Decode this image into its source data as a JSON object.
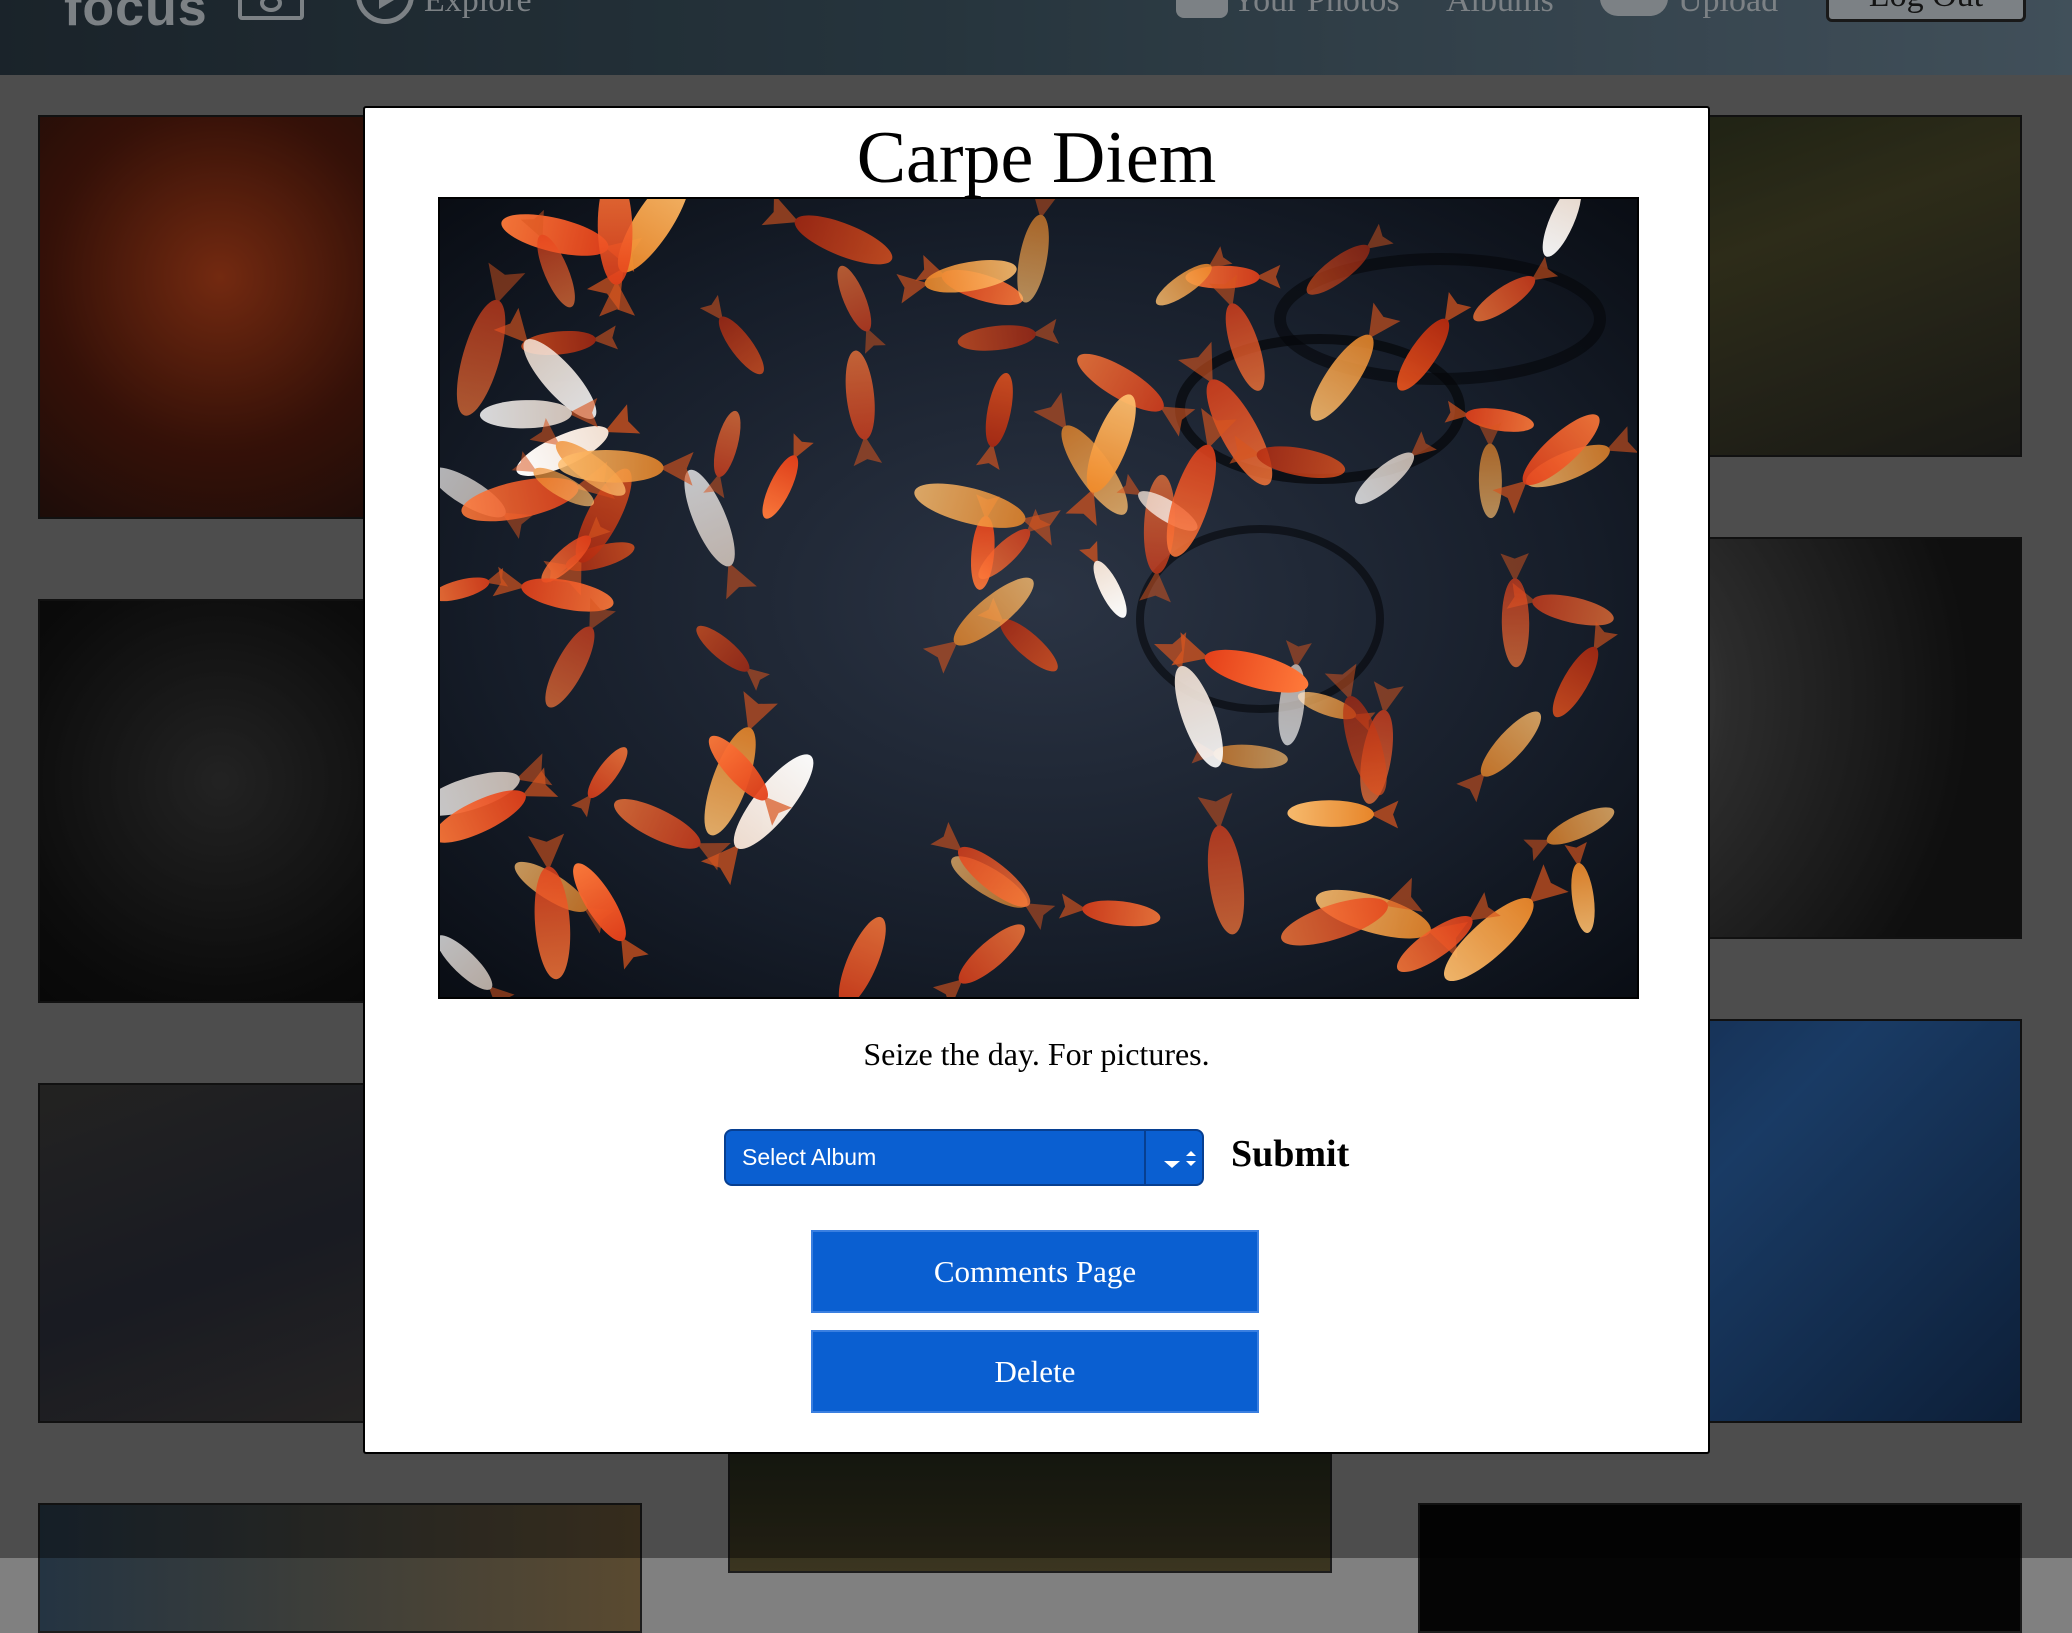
{
  "header": {
    "logo": "focus",
    "nav": {
      "explore": "Explore",
      "your_photos": "Your Photos",
      "albums": "Albums",
      "upload": "Upload",
      "logout": "Log Out"
    }
  },
  "modal": {
    "title": "Carpe Diem",
    "photo_icon": "koi-fish-photo",
    "caption": "Seize the day. For pictures.",
    "album_select": {
      "selected": "Select Album"
    },
    "submit_label": "Submit",
    "comments_label": "Comments Page",
    "delete_label": "Delete"
  },
  "colors": {
    "accent": "#0a5fd1",
    "modal_bg": "#ffffff",
    "overlay": "#808080"
  }
}
